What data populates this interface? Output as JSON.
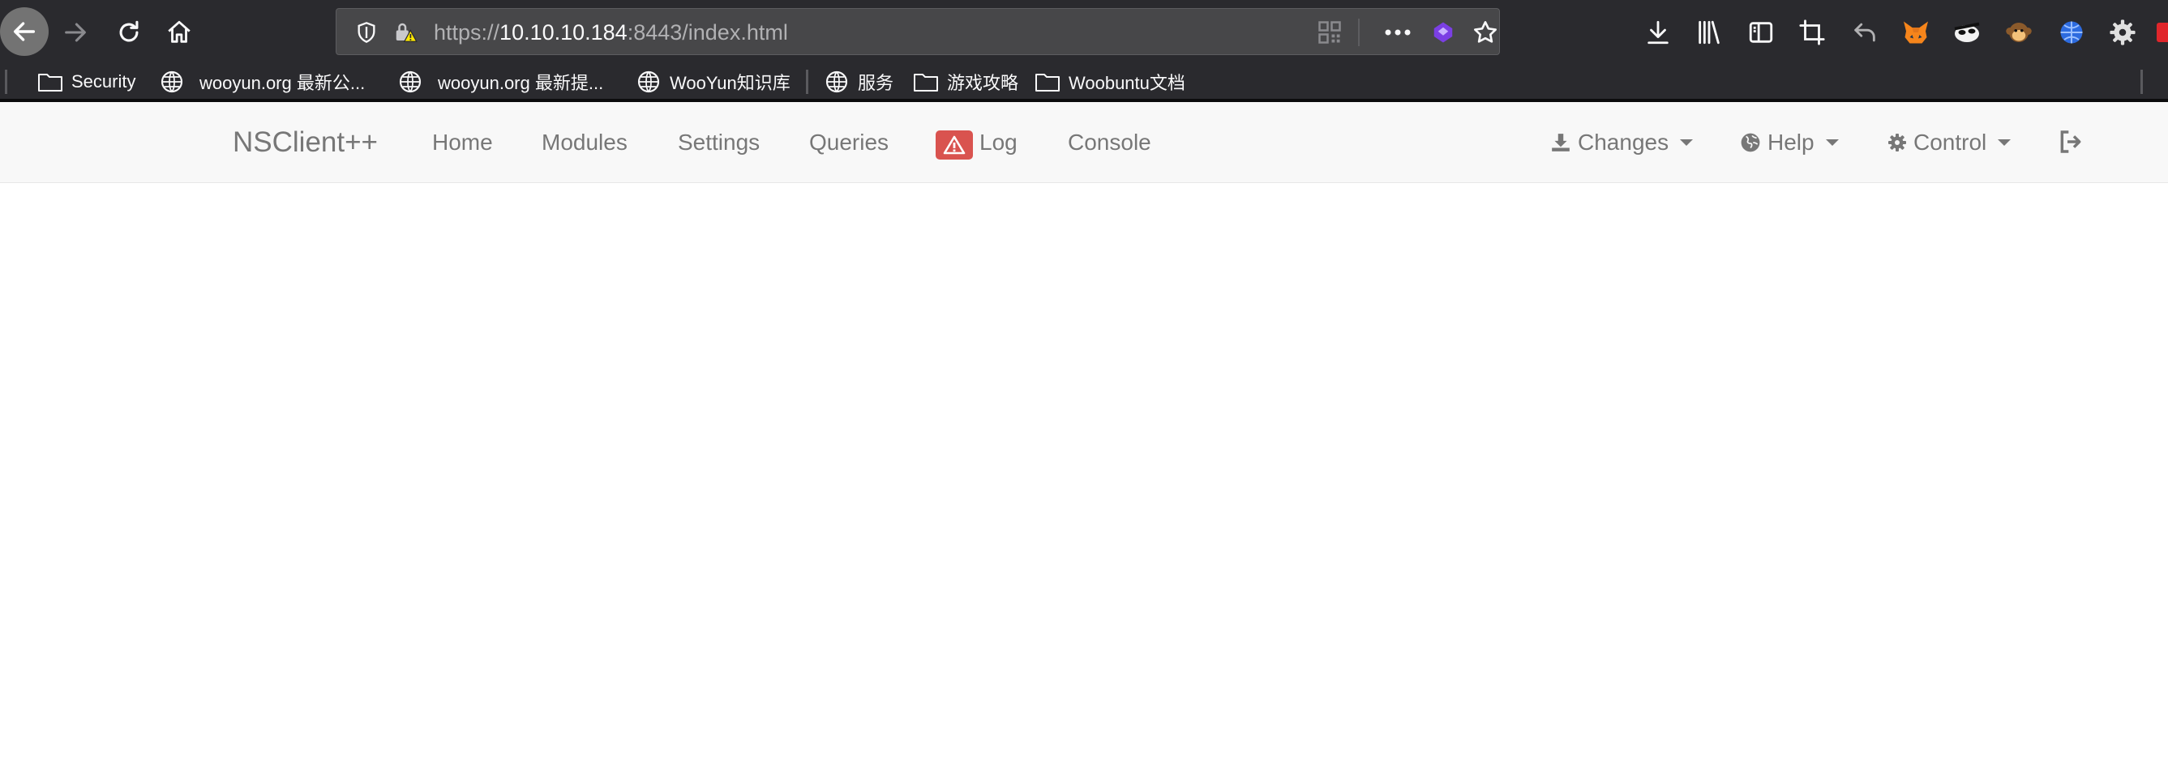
{
  "browser": {
    "url": {
      "scheme": "https://",
      "host": "10.10.10.184",
      "rest": ":8443/index.html"
    },
    "bookmarks": [
      {
        "label": "Security",
        "icon": "folder-icon"
      },
      {
        "label": "wooyun.org 最新公...",
        "icon": "globe-icon"
      },
      {
        "label": "wooyun.org 最新提...",
        "icon": "globe-icon"
      },
      {
        "label": "WooYun知识库",
        "icon": "globe-icon"
      },
      {
        "label": "服务",
        "icon": "globe-icon"
      },
      {
        "label": "游戏攻略",
        "icon": "folder-icon"
      },
      {
        "label": "Woobuntu文档",
        "icon": "folder-icon"
      }
    ]
  },
  "navbar": {
    "brand": "NSClient++",
    "items": [
      "Home",
      "Modules",
      "Settings",
      "Queries",
      "Log",
      "Console"
    ],
    "right": {
      "changes": "Changes",
      "help": "Help",
      "control": "Control"
    }
  },
  "colors": {
    "chrome": "#2a2a2e",
    "urlbar": "#474749",
    "navbar_bg": "#f8f8f8",
    "nav_text": "#777777",
    "warning_badge": "#d9534f"
  }
}
